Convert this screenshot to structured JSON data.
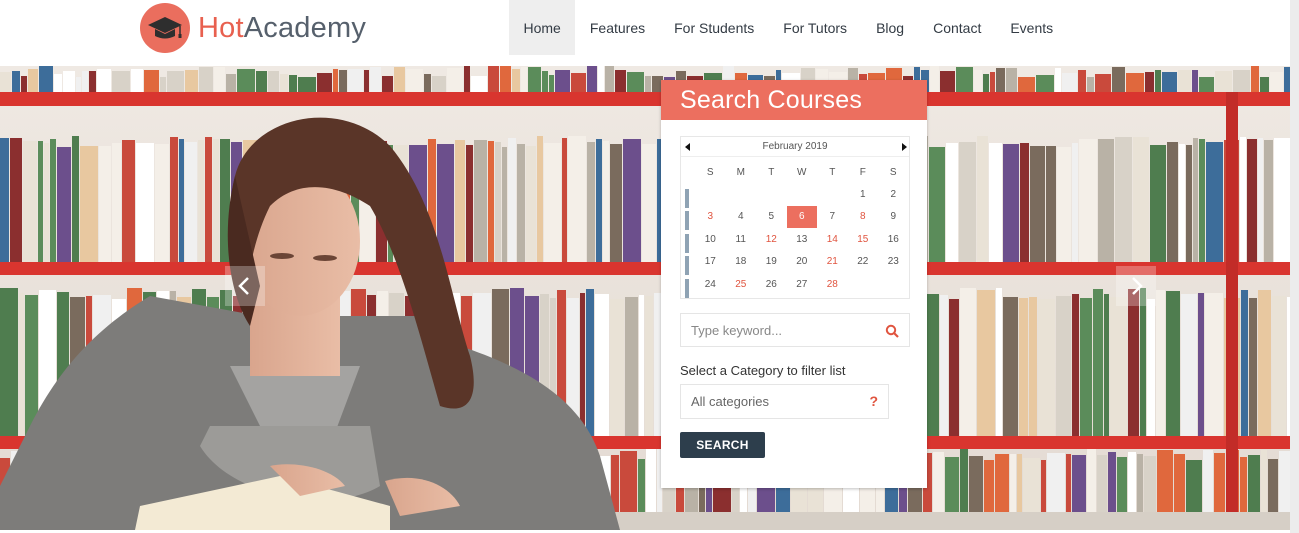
{
  "brand": {
    "hot": "Hot",
    "academy": "Academy"
  },
  "nav": {
    "items": [
      "Home",
      "Features",
      "For Students",
      "For Tutors",
      "Blog",
      "Contact",
      "Events"
    ],
    "active_index": 0
  },
  "hero": {
    "prev_icon": "chevron-left-icon",
    "next_icon": "chevron-right-icon"
  },
  "search_panel": {
    "title": "Search Courses",
    "calendar": {
      "month_label": "February 2019",
      "weekdays": [
        "S",
        "M",
        "T",
        "W",
        "T",
        "F",
        "S"
      ],
      "first_weekday_index": 5,
      "days_in_month": 28,
      "selected_day": 6,
      "highlighted_days": [
        3,
        8,
        12,
        14,
        15,
        21,
        25,
        28
      ]
    },
    "keyword": {
      "placeholder": "Type keyword...",
      "icon": "search-icon"
    },
    "category": {
      "label": "Select a Category to filter list",
      "selected": "All categories",
      "help_glyph": "?"
    },
    "search_button": "SEARCH"
  },
  "colors": {
    "accent": "#ec6f5f",
    "brand_hot": "#e8604f",
    "brand_academy": "#56606c",
    "button": "#2d3e4c",
    "nav_active_bg": "#eeeeee"
  }
}
